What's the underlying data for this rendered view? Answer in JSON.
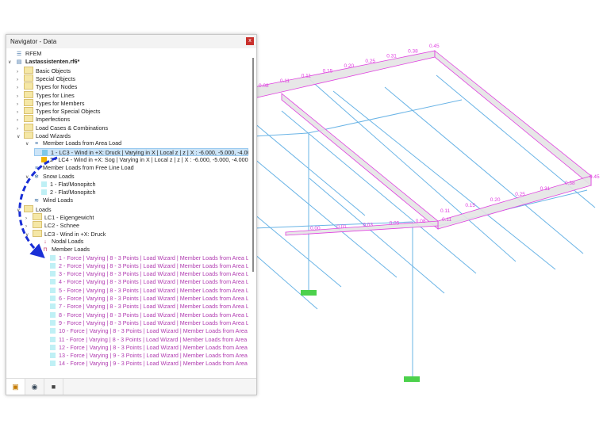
{
  "navigator": {
    "title": "Navigator - Data",
    "close_label": "x",
    "tabs": [
      "data-icon",
      "eye-icon",
      "camera-icon"
    ],
    "rows": [
      {
        "label": "RFEM",
        "indent": 0,
        "icon": "rfem",
        "chev": ""
      },
      {
        "label": "Lastassistenten.rf6*",
        "indent": 0,
        "icon": "file",
        "chev": "v",
        "bold": true
      },
      {
        "label": "Basic Objects",
        "indent": 1,
        "icon": "folder",
        "chev": ">"
      },
      {
        "label": "Special Objects",
        "indent": 1,
        "icon": "folder",
        "chev": ">"
      },
      {
        "label": "Types for Nodes",
        "indent": 1,
        "icon": "folder",
        "chev": ">"
      },
      {
        "label": "Types for Lines",
        "indent": 1,
        "icon": "folder",
        "chev": ">"
      },
      {
        "label": "Types for Members",
        "indent": 1,
        "icon": "folder",
        "chev": ">"
      },
      {
        "label": "Types for Special Objects",
        "indent": 1,
        "icon": "folder",
        "chev": ">"
      },
      {
        "label": "Imperfections",
        "indent": 1,
        "icon": "folder",
        "chev": ">"
      },
      {
        "label": "Load Cases & Combinations",
        "indent": 1,
        "icon": "folder",
        "chev": ">"
      },
      {
        "label": "Load Wizards",
        "indent": 1,
        "icon": "folder",
        "chev": "v"
      },
      {
        "label": "Member Loads from Area Load",
        "indent": 2,
        "icon": "wizard",
        "chev": "v"
      },
      {
        "label": "1 - LC3 - Wind in +X: Druck | Varying in X | Local z | z | X : -6.000, -5.000, -4.000, -3.000",
        "indent": 3,
        "icon": "sq",
        "color": "#7ec8e8",
        "chev": "",
        "selected": true
      },
      {
        "label": "2 - LC4 - Wind in +X: Sog | Varying in X | Local z | z | X : -6.000, -5.000, -4.000, -3.000",
        "indent": 3,
        "icon": "sq",
        "color": "#f0b400",
        "chev": ""
      },
      {
        "label": "Member Loads from Free Line Load",
        "indent": 2,
        "icon": "wizard",
        "chev": ""
      },
      {
        "label": "Snow Loads",
        "indent": 2,
        "icon": "snow",
        "chev": "v"
      },
      {
        "label": "1 - Flat/Monopitch",
        "indent": 3,
        "icon": "sq",
        "color": "#bff0f5",
        "chev": ""
      },
      {
        "label": "2 - Flat/Monopitch",
        "indent": 3,
        "icon": "sq",
        "color": "#bff0f5",
        "chev": ""
      },
      {
        "label": "Wind Loads",
        "indent": 2,
        "icon": "wind",
        "chev": ""
      },
      {
        "label": "Loads",
        "indent": 1,
        "icon": "folder",
        "chev": "v"
      },
      {
        "label": "LC1 - Eigengewicht",
        "indent": 2,
        "icon": "folder",
        "chev": ">"
      },
      {
        "label": "LC2 - Schnee",
        "indent": 2,
        "icon": "folder",
        "chev": ">"
      },
      {
        "label": "LC3 - Wind in +X: Druck",
        "indent": 2,
        "icon": "folder",
        "chev": "v"
      },
      {
        "label": "Nodal Loads",
        "indent": 3,
        "icon": "nodal",
        "chev": ""
      },
      {
        "label": "Member Loads",
        "indent": 3,
        "icon": "member",
        "chev": "v"
      },
      {
        "label": "1 - Force | Varying | 8 - 3 Points | Load Wizard | Member Loads from Area Load",
        "indent": 4,
        "icon": "sq",
        "color": "#bff0f5",
        "chev": "",
        "magenta": true
      },
      {
        "label": "2 - Force | Varying | 8 - 3 Points | Load Wizard | Member Loads from Area Load",
        "indent": 4,
        "icon": "sq",
        "color": "#bff0f5",
        "chev": "",
        "magenta": true
      },
      {
        "label": "3 - Force | Varying | 8 - 3 Points | Load Wizard | Member Loads from Area Load",
        "indent": 4,
        "icon": "sq",
        "color": "#bff0f5",
        "chev": "",
        "magenta": true
      },
      {
        "label": "4 - Force | Varying | 8 - 3 Points | Load Wizard | Member Loads from Area Load",
        "indent": 4,
        "icon": "sq",
        "color": "#bff0f5",
        "chev": "",
        "magenta": true
      },
      {
        "label": "5 - Force | Varying | 8 - 3 Points | Load Wizard | Member Loads from Area Load",
        "indent": 4,
        "icon": "sq",
        "color": "#bff0f5",
        "chev": "",
        "magenta": true
      },
      {
        "label": "6 - Force | Varying | 8 - 3 Points | Load Wizard | Member Loads from Area Load",
        "indent": 4,
        "icon": "sq",
        "color": "#bff0f5",
        "chev": "",
        "magenta": true
      },
      {
        "label": "7 - Force | Varying | 8 - 3 Points | Load Wizard | Member Loads from Area Load",
        "indent": 4,
        "icon": "sq",
        "color": "#bff0f5",
        "chev": "",
        "magenta": true
      },
      {
        "label": "8 - Force | Varying | 8 - 3 Points | Load Wizard | Member Loads from Area Load",
        "indent": 4,
        "icon": "sq",
        "color": "#bff0f5",
        "chev": "",
        "magenta": true
      },
      {
        "label": "9 - Force | Varying | 8 - 3 Points | Load Wizard | Member Loads from Area Load",
        "indent": 4,
        "icon": "sq",
        "color": "#bff0f5",
        "chev": "",
        "magenta": true
      },
      {
        "label": "10 - Force | Varying | 8 - 3 Points | Load Wizard | Member Loads from Area Load",
        "indent": 4,
        "icon": "sq",
        "color": "#bff0f5",
        "chev": "",
        "magenta": true
      },
      {
        "label": "11 - Force | Varying | 8 - 3 Points | Load Wizard | Member Loads from Area Load",
        "indent": 4,
        "icon": "sq",
        "color": "#bff0f5",
        "chev": "",
        "magenta": true
      },
      {
        "label": "12 - Force | Varying | 8 - 3 Points | Load Wizard | Member Loads from Area Load",
        "indent": 4,
        "icon": "sq",
        "color": "#bff0f5",
        "chev": "",
        "magenta": true
      },
      {
        "label": "13 - Force | Varying | 9 - 3 Points | Load Wizard | Member Loads from Area Load",
        "indent": 4,
        "icon": "sq",
        "color": "#bff0f5",
        "chev": "",
        "magenta": true
      },
      {
        "label": "14 - Force | Varying | 9 - 3 Points | Load Wizard | Member Loads from Area Load",
        "indent": 4,
        "icon": "sq",
        "color": "#bff0f5",
        "chev": "",
        "magenta": true
      }
    ]
  },
  "viewport": {
    "load_color": "#e040e0",
    "member_color": "#6ab4e6",
    "support_color": "#4cd14c",
    "top_edge_values": [
      "0.08",
      "0.11",
      "0.11",
      "0.15",
      "0.20",
      "0.25",
      "0.31",
      "0.38",
      "0.45"
    ],
    "right_corner_value": "0.45",
    "front_edge_values": [
      "0.11",
      "0.15",
      "0.20",
      "0.25",
      "0.31",
      "0.38"
    ],
    "lower_edge_values": [
      "0.00",
      "0.01",
      "0.03",
      "0.05",
      "0.08",
      "0.11"
    ]
  }
}
